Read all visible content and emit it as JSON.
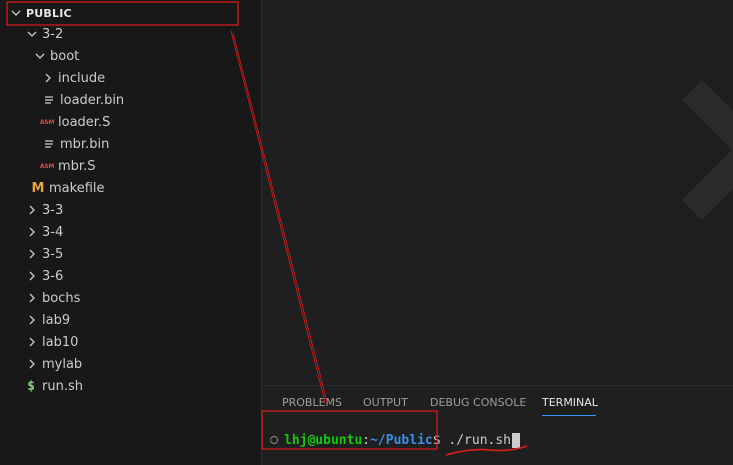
{
  "explorer": {
    "section_title": "PUBLIC",
    "items": [
      {
        "label": "3-2",
        "kind": "folder-open"
      },
      {
        "label": "boot",
        "kind": "folder-open"
      },
      {
        "label": "include",
        "kind": "folder-closed"
      },
      {
        "label": "loader.bin",
        "kind": "file-text"
      },
      {
        "label": "loader.S",
        "kind": "file-asm"
      },
      {
        "label": "mbr.bin",
        "kind": "file-text"
      },
      {
        "label": "mbr.S",
        "kind": "file-asm"
      },
      {
        "label": "makefile",
        "kind": "file-makefile"
      },
      {
        "label": "3-3",
        "kind": "folder-closed"
      },
      {
        "label": "3-4",
        "kind": "folder-closed"
      },
      {
        "label": "3-5",
        "kind": "folder-closed"
      },
      {
        "label": "3-6",
        "kind": "folder-closed"
      },
      {
        "label": "bochs",
        "kind": "folder-closed"
      },
      {
        "label": "lab9",
        "kind": "folder-closed"
      },
      {
        "label": "lab10",
        "kind": "folder-closed"
      },
      {
        "label": "mylab",
        "kind": "folder-closed"
      },
      {
        "label": "run.sh",
        "kind": "file-shell"
      }
    ],
    "asm_badge": "ASM",
    "makefile_badge": "M",
    "shell_badge": "$"
  },
  "panel": {
    "tabs": [
      {
        "label": "PROBLEMS"
      },
      {
        "label": "OUTPUT"
      },
      {
        "label": "DEBUG CONSOLE"
      },
      {
        "label": "TERMINAL",
        "active": true
      }
    ],
    "terminal": {
      "user_host": "lhj@ubuntu",
      "separator": ":",
      "path": "~/Public",
      "prompt": "$ ",
      "command": "./run.sh"
    }
  },
  "colors": {
    "annotation": "#e01b1b",
    "accent": "#3794ff",
    "terminal_user": "#16c60c",
    "terminal_path": "#3b8eea"
  },
  "icons": {
    "chevron_down": "chevron-down-icon",
    "chevron_right": "chevron-right-icon",
    "file_lines": "file-lines-icon",
    "asm": "asm-file-icon",
    "makefile": "makefile-icon",
    "shell": "shell-script-icon",
    "watermark": "vscode-logo-watermark"
  }
}
